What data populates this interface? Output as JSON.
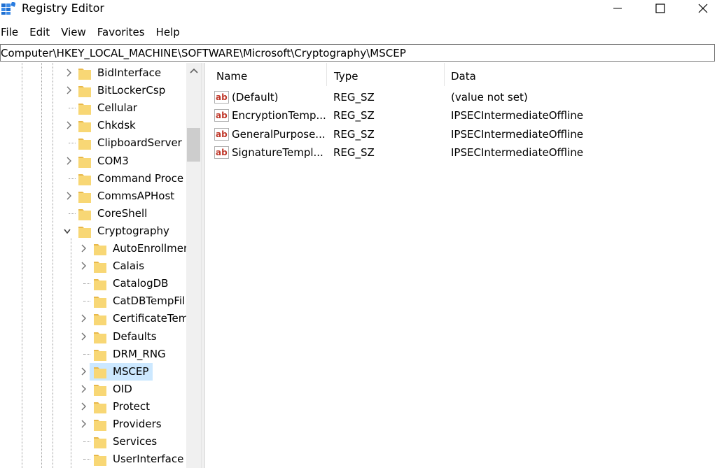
{
  "window": {
    "title": "Registry Editor"
  },
  "menu": {
    "items": [
      "File",
      "Edit",
      "View",
      "Favorites",
      "Help"
    ]
  },
  "address": {
    "path": "Computer\\HKEY_LOCAL_MACHINE\\SOFTWARE\\Microsoft\\Cryptography\\MSCEP"
  },
  "tree": {
    "items": [
      {
        "label": "BidInterface",
        "level": 0,
        "expander": "collapsed"
      },
      {
        "label": "BitLockerCsp",
        "level": 0,
        "expander": "collapsed"
      },
      {
        "label": "Cellular",
        "level": 0,
        "expander": "none"
      },
      {
        "label": "Chkdsk",
        "level": 0,
        "expander": "collapsed"
      },
      {
        "label": "ClipboardServer",
        "level": 0,
        "expander": "none"
      },
      {
        "label": "COM3",
        "level": 0,
        "expander": "collapsed"
      },
      {
        "label": "Command Proce",
        "level": 0,
        "expander": "none"
      },
      {
        "label": "CommsAPHost",
        "level": 0,
        "expander": "collapsed"
      },
      {
        "label": "CoreShell",
        "level": 0,
        "expander": "none"
      },
      {
        "label": "Cryptography",
        "level": 0,
        "expander": "expanded"
      },
      {
        "label": "AutoEnrollmer",
        "level": 1,
        "expander": "collapsed"
      },
      {
        "label": "Calais",
        "level": 1,
        "expander": "collapsed"
      },
      {
        "label": "CatalogDB",
        "level": 1,
        "expander": "none"
      },
      {
        "label": "CatDBTempFil",
        "level": 1,
        "expander": "none"
      },
      {
        "label": "CertificateTem",
        "level": 1,
        "expander": "collapsed"
      },
      {
        "label": "Defaults",
        "level": 1,
        "expander": "collapsed"
      },
      {
        "label": "DRM_RNG",
        "level": 1,
        "expander": "none"
      },
      {
        "label": "MSCEP",
        "level": 1,
        "expander": "collapsed",
        "selected": true
      },
      {
        "label": "OID",
        "level": 1,
        "expander": "collapsed"
      },
      {
        "label": "Protect",
        "level": 1,
        "expander": "collapsed"
      },
      {
        "label": "Providers",
        "level": 1,
        "expander": "collapsed"
      },
      {
        "label": "Services",
        "level": 1,
        "expander": "none"
      },
      {
        "label": "UserInterface",
        "level": 1,
        "expander": "none"
      }
    ]
  },
  "list": {
    "columns": {
      "name": "Name",
      "type": "Type",
      "data": "Data"
    },
    "rows": [
      {
        "name": "(Default)",
        "type": "REG_SZ",
        "data": "(value not set)"
      },
      {
        "name": "EncryptionTemp...",
        "type": "REG_SZ",
        "data": "IPSECIntermediateOffline"
      },
      {
        "name": "GeneralPurpose...",
        "type": "REG_SZ",
        "data": "IPSECIntermediateOffline"
      },
      {
        "name": "SignatureTempl...",
        "type": "REG_SZ",
        "data": "IPSECIntermediateOffline"
      }
    ]
  },
  "colors": {
    "selection": "#cce8ff",
    "folder": "#f8d775",
    "folder_dark": "#e8b84a",
    "value_icon": "#c0392b"
  },
  "icons": {
    "app": "registry-icon",
    "minimize": "minimize-icon",
    "maximize": "maximize-icon",
    "close": "close-icon",
    "folder": "folder-icon",
    "value": "string-value-icon"
  }
}
